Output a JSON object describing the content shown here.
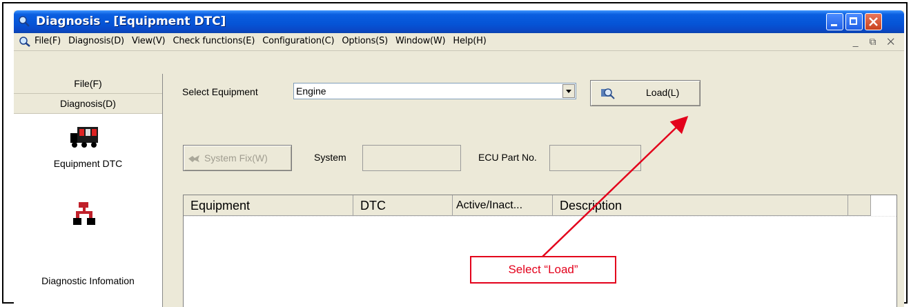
{
  "window": {
    "title": "Diagnosis - [Equipment DTC]",
    "accent": "#0554d6"
  },
  "menubar": {
    "items": [
      "File(F)",
      "Diagnosis(D)",
      "View(V)",
      "Check functions(E)",
      "Configuration(C)",
      "Options(S)",
      "Window(W)",
      "Help(H)"
    ],
    "mdi_controls": "_ ⧉ ✕"
  },
  "sidebar": {
    "file_header": "File(F)",
    "diagnosis_header": "Diagnosis(D)",
    "items": [
      {
        "label": "Equipment DTC",
        "icon": "equipment-dtc-icon"
      },
      {
        "label": "Diagnostic Infomation",
        "icon": "diagnostic-info-icon"
      }
    ]
  },
  "content": {
    "select_label": "Select Equipment",
    "select_value": "Engine",
    "load_label": "Load(L)",
    "system_fix_label": "System Fix(W)",
    "system_label": "System",
    "ecu_label": "ECU Part No.",
    "columns": [
      "Equipment",
      "DTC",
      "Active/Inact...",
      "Description"
    ]
  },
  "annotation": {
    "text": "Select “Load”",
    "color": "#e3001b"
  }
}
